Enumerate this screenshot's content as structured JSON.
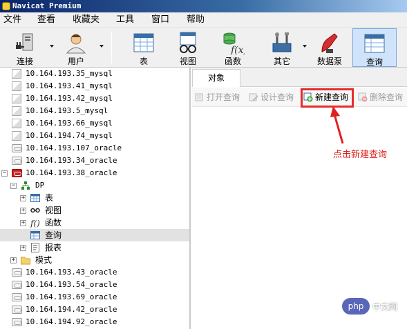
{
  "window": {
    "title": "Navicat Premium"
  },
  "menu": [
    "文件",
    "查看",
    "收藏夹",
    "工具",
    "窗口",
    "帮助"
  ],
  "toolbar": {
    "buttons": [
      {
        "label": "连接",
        "icon": "connection-icon"
      },
      {
        "label": "用户",
        "icon": "user-icon"
      },
      {
        "label": "表",
        "icon": "table-icon"
      },
      {
        "label": "视图",
        "icon": "view-icon"
      },
      {
        "label": "函数",
        "icon": "function-icon"
      },
      {
        "label": "其它",
        "icon": "tools-icon"
      },
      {
        "label": "数据泵",
        "icon": "data-pump-icon"
      },
      {
        "label": "查询",
        "icon": "query-icon",
        "active": true
      }
    ]
  },
  "tree": {
    "connections": [
      {
        "label": "10.164.193.35_mysql"
      },
      {
        "label": "10.164.193.41_mysql"
      },
      {
        "label": "10.164.193.42_mysql"
      },
      {
        "label": "10.164.193.5_mysql"
      },
      {
        "label": "10.164.193.66_mysql"
      },
      {
        "label": "10.164.194.74_mysql"
      },
      {
        "label": "10.164.193.107_oracle"
      },
      {
        "label": "10.164.193.34_oracle"
      },
      {
        "label": "10.164.193.38_oracle",
        "expanded": true
      },
      {
        "label": "DP"
      },
      {
        "label": "表"
      },
      {
        "label": "视图"
      },
      {
        "label": "函数"
      },
      {
        "label": "查询",
        "selected": true
      },
      {
        "label": "报表"
      },
      {
        "label": "模式"
      },
      {
        "label": "10.164.193.43_oracle"
      },
      {
        "label": "10.164.193.54_oracle"
      },
      {
        "label": "10.164.193.69_oracle"
      },
      {
        "label": "10.164.194.42_oracle"
      },
      {
        "label": "10.164.194.92_oracle"
      }
    ]
  },
  "objects": {
    "tab": "对象",
    "actions": {
      "open": "打开查询",
      "design": "设计查询",
      "new": "新建查询",
      "delete": "删除查询"
    }
  },
  "annotation": {
    "text": "点击新建查询"
  },
  "watermark": {
    "logo": "php",
    "text": "中文网"
  },
  "colors": {
    "highlight": "#e62b2b",
    "titlebar": "#0a246a",
    "oracle_active": "#cc2222"
  }
}
